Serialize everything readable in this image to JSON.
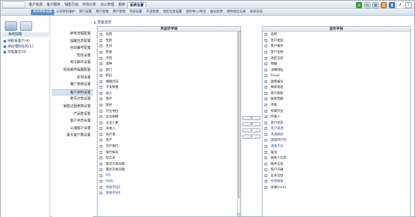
{
  "topnav": {
    "items": [
      "客户资源",
      "客户服务",
      "销售行动",
      "市场分析",
      "办公管理",
      "报表",
      "系统设置"
    ],
    "active_index": 6,
    "tool_icons": [
      "home-icon",
      "document-icon",
      "calendar-icon",
      "bookshelf-icon",
      "chart-icon",
      "tools-icon",
      "help-icon"
    ]
  },
  "subnav": {
    "items": [
      "系统参数设置",
      "公司资料维护",
      "部门设置",
      "用户管理",
      "用户管理",
      "字段设置",
      "产品管理",
      "地区信息设置",
      "资料导入/导出",
      "备份还原",
      "邮件短信记录",
      "系统日志"
    ],
    "active_index": 0
  },
  "sidebar": {
    "title": "系统提醒",
    "items": [
      "待联系客户(4)",
      "待处理的任务(1)",
      "日程备忘(0)"
    ]
  },
  "settings_menu": {
    "items": [
      "审核流程配置",
      "提醒信息配置",
      "自动编号配置",
      "短信设置",
      "电子邮件设置",
      "短信邮件提醒配置",
      "折扣设置",
      "推广参数设置",
      "客户资料设置",
      "帐页打款设置",
      "销售过程参数设置",
      "产品数设置",
      "客户状态设置",
      "公海客户设置",
      "最大客户数设置"
    ],
    "active_index": 8
  },
  "content": {
    "title": "配置选项",
    "left_header": "未显示字段",
    "right_header": "显示字段",
    "left_fields": [
      "名称",
      "性别",
      "生日",
      "民族",
      "学历",
      "道种",
      "部门",
      "职位",
      "婚姻状况",
      "子女数量",
      "收入",
      "偶产",
      "爱好",
      "行业地位",
      "企业规模",
      "企业人数",
      "净收入",
      "总产值",
      "资产",
      "开户银行",
      "银行帐号",
      "纪念日",
      "首次交易日期",
      "最近交易日期",
      "QQ",
      "MSN",
      "预留字段5",
      "预留字段6"
    ],
    "left_blue_from": 24,
    "right_fields": [
      "名称",
      "客户类型",
      "客户编号",
      "客户名称",
      "地区信息",
      "邮编",
      "详细地址",
      "Email",
      "国家编号",
      "联系电话",
      "客户级别",
      "联系周期",
      "传真",
      "所属行业",
      "所属人",
      "客户状态",
      "客户来源",
      "来源路径",
      "其他开户行",
      "来源卡号",
      "备注",
      "联系人信息",
      "服务信息",
      "客户沟通",
      "业务信息",
      "共同联系",
      "关联Email"
    ],
    "right_highlight": [
      16,
      17,
      19,
      25
    ],
    "move_buttons": [
      ">",
      "<",
      "»",
      "«"
    ]
  },
  "colors": {
    "accent": "#5b8cc4",
    "link_blue": "#2a4cae"
  }
}
